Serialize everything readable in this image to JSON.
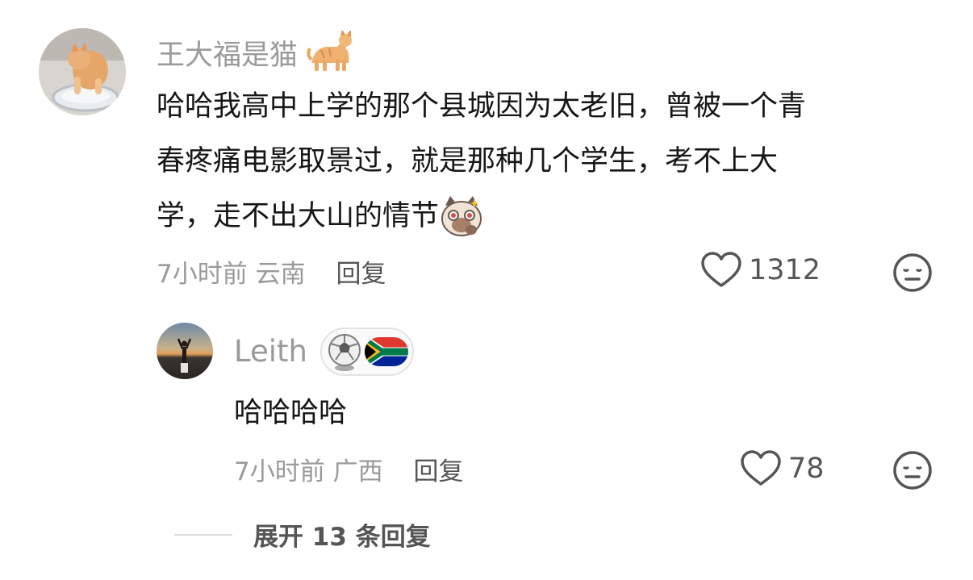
{
  "comment": {
    "username": "王大福是猫",
    "username_emoji": "🐈",
    "text_lines": [
      "哈哈我高中上学的那个县城因为太老旧，曾被一个青",
      "春疼痛电影取景过，就是那种几个学生，考不上大",
      "学，走不出大山的情节"
    ],
    "sticker": "cat-sticker-icon",
    "time": "7小时前",
    "location": "云南",
    "reply_label": "回复",
    "likes": "1312"
  },
  "reply": {
    "username": "Leith",
    "badges": [
      "soccer-ball-icon",
      "south-africa-flag-icon"
    ],
    "text": "哈哈哈哈",
    "time": "7小时前",
    "location": "广西",
    "reply_label": "回复",
    "likes": "78"
  },
  "expand": {
    "label": "展开 13 条回复"
  },
  "colors": {
    "muted": "#9a9a9a",
    "action": "#555555",
    "text": "#161616"
  }
}
